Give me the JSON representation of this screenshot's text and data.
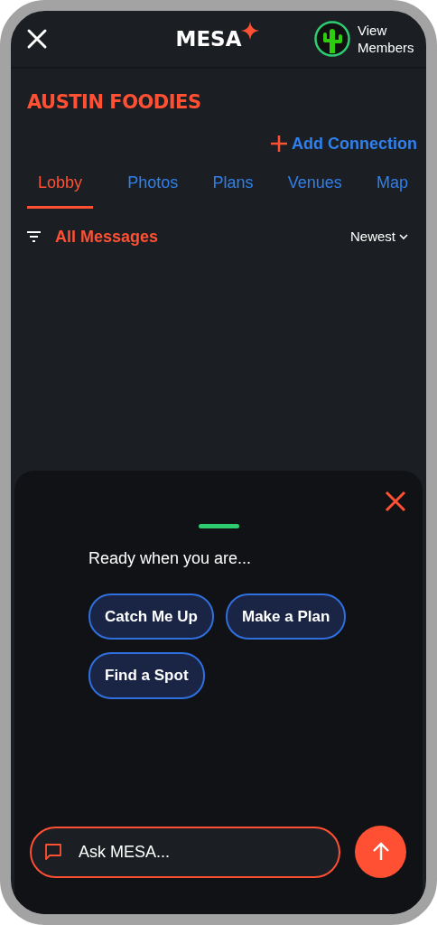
{
  "header": {
    "logo": "MESA",
    "members_link": "View Members"
  },
  "group_title": "AUSTIN FOODIES",
  "add_connection": "Add Connection",
  "tabs": [
    {
      "label": "Lobby",
      "selected": true
    },
    {
      "label": "Photos",
      "selected": false
    },
    {
      "label": "Plans",
      "selected": false
    },
    {
      "label": "Venues",
      "selected": false
    },
    {
      "label": "Map",
      "selected": false
    }
  ],
  "filter": {
    "label": "All Messages"
  },
  "sort": {
    "label": "Newest"
  },
  "assistant": {
    "prompt": "Ready when you are...",
    "suggestions": [
      "Catch Me Up",
      "Make a Plan",
      "Find a Spot"
    ],
    "input": {
      "placeholder": "Ask MESA..."
    }
  }
}
